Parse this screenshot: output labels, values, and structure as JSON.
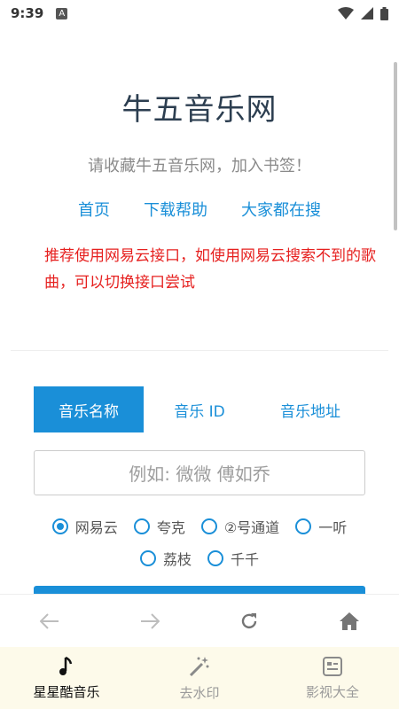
{
  "status_bar": {
    "time": "9:39",
    "notification_glyph": "A"
  },
  "site": {
    "title": "牛五音乐网",
    "subtitle": "请收藏牛五音乐网，加入书签！",
    "nav_links": [
      "首页",
      "下载帮助",
      "大家都在搜"
    ],
    "notice": "推荐使用网易云接口，如使用网易云搜索不到的歌曲，可以切换接口尝试"
  },
  "search": {
    "tabs": [
      "音乐名称",
      "音乐 ID",
      "音乐地址"
    ],
    "active_tab": "音乐名称",
    "placeholder": "例如: 微微 傅如乔",
    "sources": [
      {
        "label": "网易云",
        "selected": true
      },
      {
        "label": "夸克",
        "selected": false
      },
      {
        "label": "②号通道",
        "selected": false
      },
      {
        "label": "一听",
        "selected": false
      },
      {
        "label": "荔枝",
        "selected": false
      },
      {
        "label": "千千",
        "selected": false
      }
    ]
  },
  "browser_toolbar": {
    "icons": [
      "back-arrow-icon",
      "forward-arrow-icon",
      "refresh-icon",
      "home-icon"
    ]
  },
  "bottom_nav": [
    {
      "label": "星星酷音乐",
      "icon": "music-note-icon",
      "active": true
    },
    {
      "label": "去水印",
      "icon": "magic-wand-icon",
      "active": false
    },
    {
      "label": "影视大全",
      "icon": "video-list-icon",
      "active": false
    }
  ],
  "colors": {
    "accent": "#1a8fd8",
    "notice": "#e6201f",
    "title": "#2c3e50",
    "bottom_nav_bg": "#fdfaea"
  }
}
